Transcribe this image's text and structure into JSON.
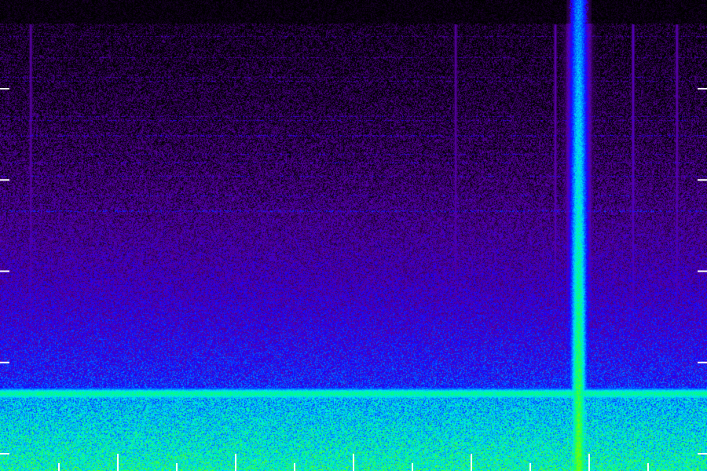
{
  "chart_data": {
    "type": "heatmap",
    "title": "",
    "xlabel": "",
    "ylabel": "",
    "x_ticks": {
      "major_count": 6,
      "minor_count": 6
    },
    "y_ticks": {
      "count": 5
    },
    "grid": false,
    "legend": "none",
    "colormap": [
      "#000000",
      "#3a0066",
      "#5a00b0",
      "#1400ff",
      "#0066ff",
      "#00e0ff",
      "#00ff80",
      "#7aff00"
    ],
    "features": [
      {
        "name": "strong-horizontal-band",
        "kind": "horizontal",
        "y_fraction_from_bottom": 0.165,
        "intensity": 0.9
      },
      {
        "name": "strong-vertical-burst",
        "kind": "vertical",
        "x_fraction": 0.818,
        "intensity": 0.95
      },
      {
        "name": "vertical-line-a",
        "kind": "vertical",
        "x_fraction": 0.043,
        "intensity": 0.4
      },
      {
        "name": "vertical-line-b",
        "kind": "vertical",
        "x_fraction": 0.644,
        "intensity": 0.4
      },
      {
        "name": "vertical-line-c",
        "kind": "vertical",
        "x_fraction": 0.785,
        "intensity": 0.45
      },
      {
        "name": "vertical-line-d",
        "kind": "vertical",
        "x_fraction": 0.895,
        "intensity": 0.5
      },
      {
        "name": "vertical-line-e",
        "kind": "vertical",
        "x_fraction": 0.957,
        "intensity": 0.45
      }
    ],
    "tick_color": "#ffffff"
  }
}
